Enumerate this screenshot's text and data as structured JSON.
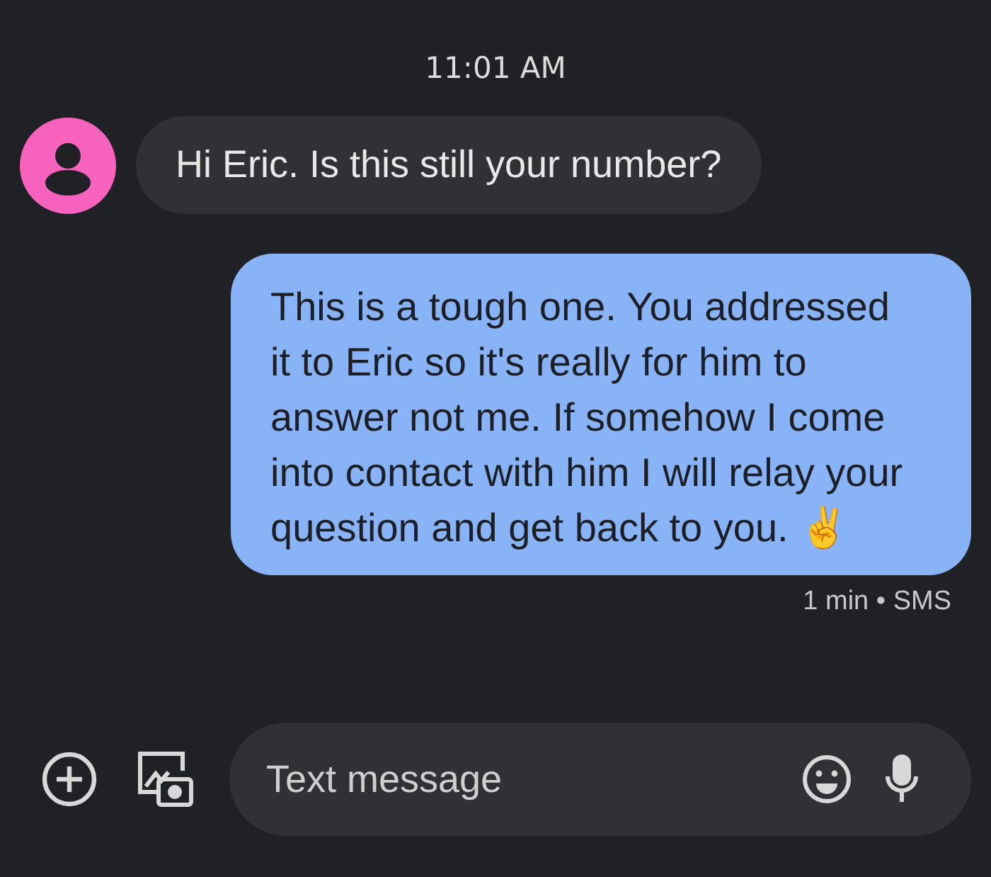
{
  "timestamp": "11:01 AM",
  "messages": [
    {
      "kind": "incoming",
      "text": "Hi Eric. Is this still your number?",
      "color": "#f862bf"
    },
    {
      "kind": "outgoing",
      "text": "This is a tough one. You addressed it to Eric so it's really for him to answer not me. If somehow I come into contact with him I will relay your question and get back to you. ✌️",
      "meta": "1 min • SMS"
    }
  ],
  "compose": {
    "placeholder": "Text message"
  }
}
